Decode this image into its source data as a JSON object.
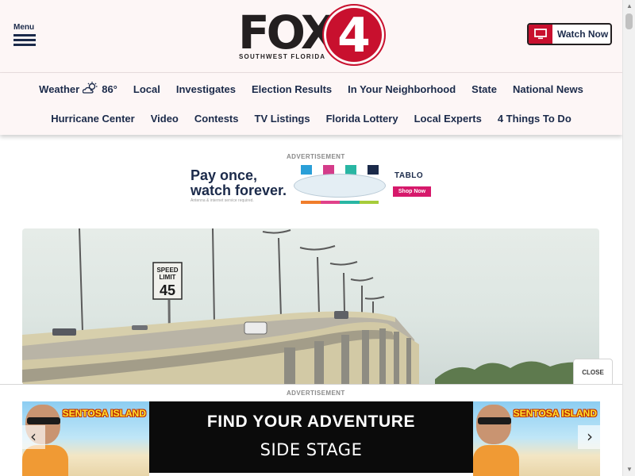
{
  "header": {
    "menu_label": "Menu",
    "logo": {
      "word": "FOX",
      "number": "4",
      "subtitle": "SOUTHWEST FLORIDA"
    },
    "watch_now_label": "Watch Now",
    "colors": {
      "brand_red": "#c8102e",
      "navy": "#1b2a4a"
    }
  },
  "nav": {
    "row1": [
      {
        "label": "Weather",
        "temp": "86°",
        "icon": "partly-cloudy-icon"
      },
      {
        "label": "Local"
      },
      {
        "label": "Investigates"
      },
      {
        "label": "Election Results"
      },
      {
        "label": "In Your Neighborhood"
      },
      {
        "label": "State"
      },
      {
        "label": "National News"
      }
    ],
    "row2": [
      {
        "label": "Hurricane Center"
      },
      {
        "label": "Video"
      },
      {
        "label": "Contests"
      },
      {
        "label": "TV Listings"
      },
      {
        "label": "Florida Lottery"
      },
      {
        "label": "Local Experts"
      },
      {
        "label": "4 Things To Do"
      }
    ]
  },
  "ad_top": {
    "label": "ADVERTISEMENT",
    "headline_1": "Pay once,",
    "headline_2": "watch forever.",
    "small_print": "Antenna & internet service required.",
    "brand": "TABLO",
    "cta": "Shop Now"
  },
  "hero": {
    "alt": "Bridge with speed limit sign",
    "sign_top": "SPEED",
    "sign_mid": "LIMIT",
    "sign_value": "45"
  },
  "close_label": "CLOSE",
  "ad_bottom": {
    "label": "ADVERTISEMENT",
    "panel_title": "SENTOSA ISLAND",
    "headline": "FIND YOUR ADVENTURE",
    "brand": "SIDE STAGE",
    "prev_arrow": "‹",
    "next_arrow": "›"
  }
}
